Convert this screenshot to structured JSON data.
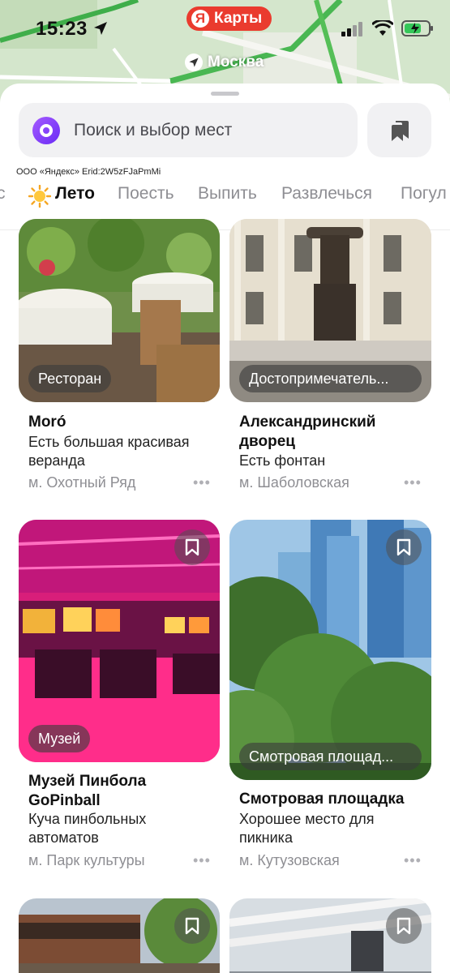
{
  "status_bar": {
    "time": "15:23",
    "brand": "Карты",
    "brand_letter": "Я"
  },
  "map": {
    "city": "Москва"
  },
  "search": {
    "placeholder": "Поиск и выбор мест"
  },
  "ad_disclaimer": "ООО «Яндекс» Erid:2W5zFJaPmMi",
  "tabs": [
    {
      "label": "с"
    },
    {
      "label": "Лето",
      "active": true,
      "icon": "sun-icon"
    },
    {
      "label": "Поесть"
    },
    {
      "label": "Выпить"
    },
    {
      "label": "Развлечься"
    },
    {
      "label": "Погул"
    }
  ],
  "cards": [
    {
      "category": "Ресторан",
      "title": "Moró",
      "description": "Есть большая красивая веранда",
      "metro": "м. Охотный Ряд",
      "more": "•••"
    },
    {
      "category": "Достопримечатель...",
      "title": "Александринский дворец",
      "description": "Есть фонтан",
      "metro": "м. Шаболовская",
      "more": "•••"
    },
    {
      "category": "Музей",
      "title": "Музей Пинбола GoPinball",
      "description": "Куча пинбольных автоматов",
      "metro": "м. Парк культуры",
      "more": "•••"
    },
    {
      "category": "Смотровая площад...",
      "title": "Смотровая площадка",
      "description": "Хорошее место для пикника",
      "metro": "м. Кутузовская",
      "more": "•••"
    }
  ],
  "colors": {
    "brand_red": "#ea3b2e",
    "alice_purple": "#7b3cf6",
    "map_green": "#cfe2c8"
  }
}
